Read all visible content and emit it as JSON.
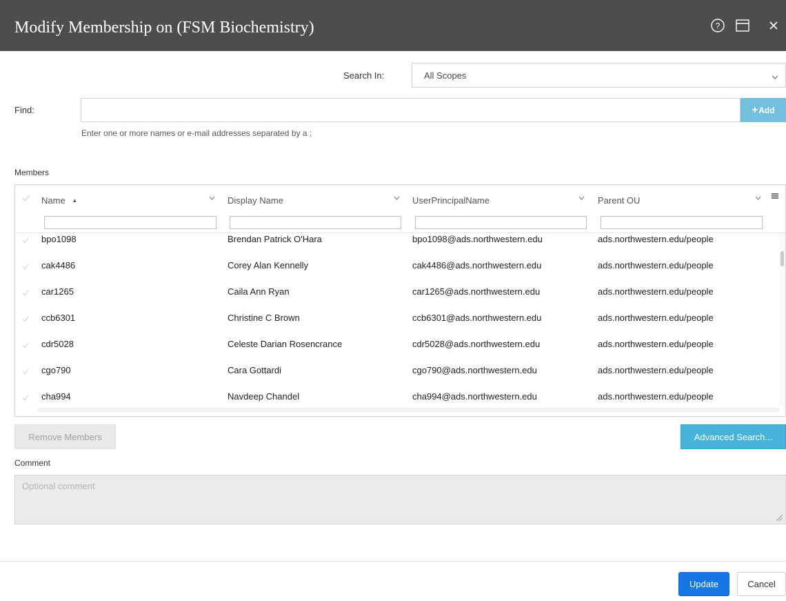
{
  "dialog": {
    "title": "Modify Membership on (FSM Biochemistry)",
    "icons": [
      "help-icon",
      "window-icon",
      "close-icon"
    ]
  },
  "search_in": {
    "label": "Search In:",
    "value": "All Scopes"
  },
  "find": {
    "label": "Find:",
    "value": "",
    "add_label": "Add",
    "hint": "Enter one or more names or e-mail addresses separated by a ;"
  },
  "members": {
    "label": "Members",
    "columns": [
      "Name",
      "Display Name",
      "UserPrincipalName",
      "Parent OU"
    ],
    "sort": {
      "column": "Name",
      "direction": "ascending"
    },
    "rows": [
      [
        "bpo1098",
        "Brendan Patrick O'Hara",
        "bpo1098@ads.northwestern.edu",
        "ads.northwestern.edu/people"
      ],
      [
        "cak4486",
        "Corey Alan Kennelly",
        "cak4486@ads.northwestern.edu",
        "ads.northwestern.edu/people"
      ],
      [
        "car1265",
        "Caila Ann Ryan",
        "car1265@ads.northwestern.edu",
        "ads.northwestern.edu/people"
      ],
      [
        "ccb6301",
        "Christine C Brown",
        "ccb6301@ads.northwestern.edu",
        "ads.northwestern.edu/people"
      ],
      [
        "cdr5028",
        "Celeste Darian Rosencrance",
        "cdr5028@ads.northwestern.edu",
        "ads.northwestern.edu/people"
      ],
      [
        "cgo790",
        "Cara Gottardi",
        "cgo790@ads.northwestern.edu",
        "ads.northwestern.edu/people"
      ],
      [
        "cha994",
        "Navdeep Chandel",
        "cha994@ads.northwestern.edu",
        "ads.northwestern.edu/people"
      ]
    ]
  },
  "buttons": {
    "remove": "Remove Members",
    "advanced": "Advanced Search...",
    "update": "Update",
    "cancel": "Cancel"
  },
  "comment": {
    "label": "Comment",
    "placeholder": "Optional comment",
    "value": ""
  },
  "colors": {
    "titlebar": "#4d4d4d",
    "add_button": "#72c0de",
    "advanced_button": "#46b4da",
    "update_button": "#1577e6"
  }
}
